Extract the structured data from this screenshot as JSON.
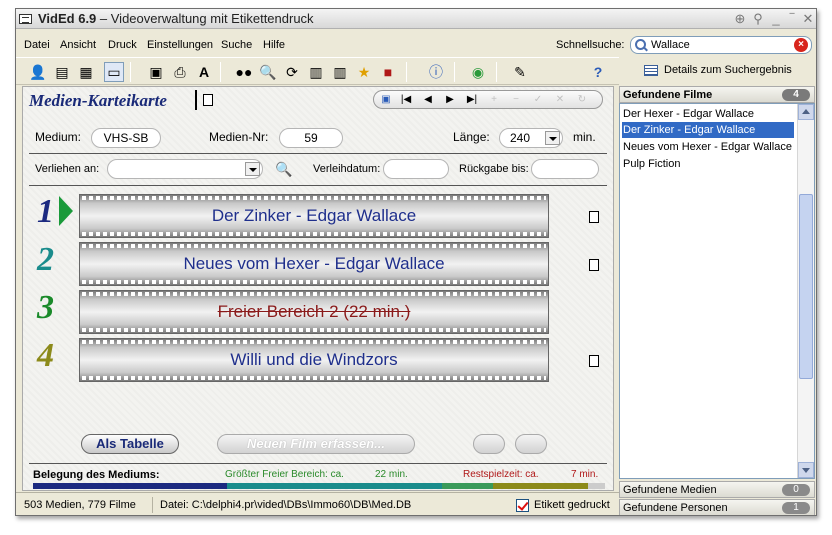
{
  "window": {
    "app_name": "VidEd 6.9",
    "title_rest": " – Videoverwaltung mit Etikettendruck"
  },
  "menu": {
    "items": [
      "Datei",
      "Ansicht",
      "Druck",
      "Einstellungen",
      "Suche",
      "Hilfe"
    ],
    "quicksearch_label": "Schnellsuche:",
    "quicksearch_value": "Wallace"
  },
  "toolbar": {
    "details_label": "Details zum Suchergebnis"
  },
  "card": {
    "title": "Medien-Karteikarte",
    "medium_label": "Medium:",
    "medium_value": "VHS-SB",
    "nr_label": "Medien-Nr:",
    "nr_value": "59",
    "laenge_label": "Länge:",
    "laenge_value": "240",
    "laenge_unit": "min.",
    "verliehen_label": "Verliehen an:",
    "verliehen_value": "",
    "verleihdatum_label": "Verleihdatum:",
    "verleihdatum_value": "",
    "rueckgabe_label": "Rückgabe bis:",
    "rueckgabe_value": ""
  },
  "films": [
    {
      "num": "1",
      "title": "Der Zinker - Edgar Wallace",
      "color": "#1c2a80",
      "strike": false
    },
    {
      "num": "2",
      "title": "Neues vom Hexer - Edgar Wallace",
      "color": "#1a8c8c",
      "strike": false
    },
    {
      "num": "3",
      "title": "Freier Bereich 2 (22 min.)",
      "color": "#1a8a2a",
      "strike": true
    },
    {
      "num": "4",
      "title": "Willi und die Windzors",
      "color": "#8c8a1a",
      "strike": false
    }
  ],
  "actions": {
    "table_btn": "Als Tabelle",
    "new_film_btn": "Neuen Film erfassen..."
  },
  "usage": {
    "label": "Belegung des Mediums:",
    "free_label": "Größter Freier Bereich: ca.",
    "free_value": "22 min.",
    "rest_label": "Restspielzeit: ca.",
    "rest_value": "7 min.",
    "segments": [
      {
        "name": "film1",
        "start": 0,
        "end": 0.34,
        "color": "#1c2a80"
      },
      {
        "name": "film2",
        "start": 0.34,
        "end": 0.715,
        "color": "#1a8c8c"
      },
      {
        "name": "free",
        "start": 0.715,
        "end": 0.805,
        "color": "#3a9a5a"
      },
      {
        "name": "film4",
        "start": 0.805,
        "end": 0.97,
        "color": "#8c8a1a"
      },
      {
        "name": "rest",
        "start": 0.97,
        "end": 1.0,
        "color": "#cccccc"
      }
    ]
  },
  "status": {
    "counts": "503 Medien, 779 Filme",
    "db_path": "Datei: C:\\delphi4.pr\\vided\\DBs\\Immo60\\DB\\Med.DB",
    "etikett_label": "Etikett gedruckt"
  },
  "right_panel": {
    "found_films_label": "Gefundene Filme",
    "found_films_count": "4",
    "results": [
      "Der Hexer - Edgar Wallace",
      "Der Zinker - Edgar Wallace",
      "Neues vom Hexer - Edgar Wallace",
      "Pulp Fiction"
    ],
    "selected_index": 1,
    "found_media_label": "Gefundene Medien",
    "found_media_count": "0",
    "found_persons_label": "Gefundene Personen",
    "found_persons_count": "1"
  }
}
